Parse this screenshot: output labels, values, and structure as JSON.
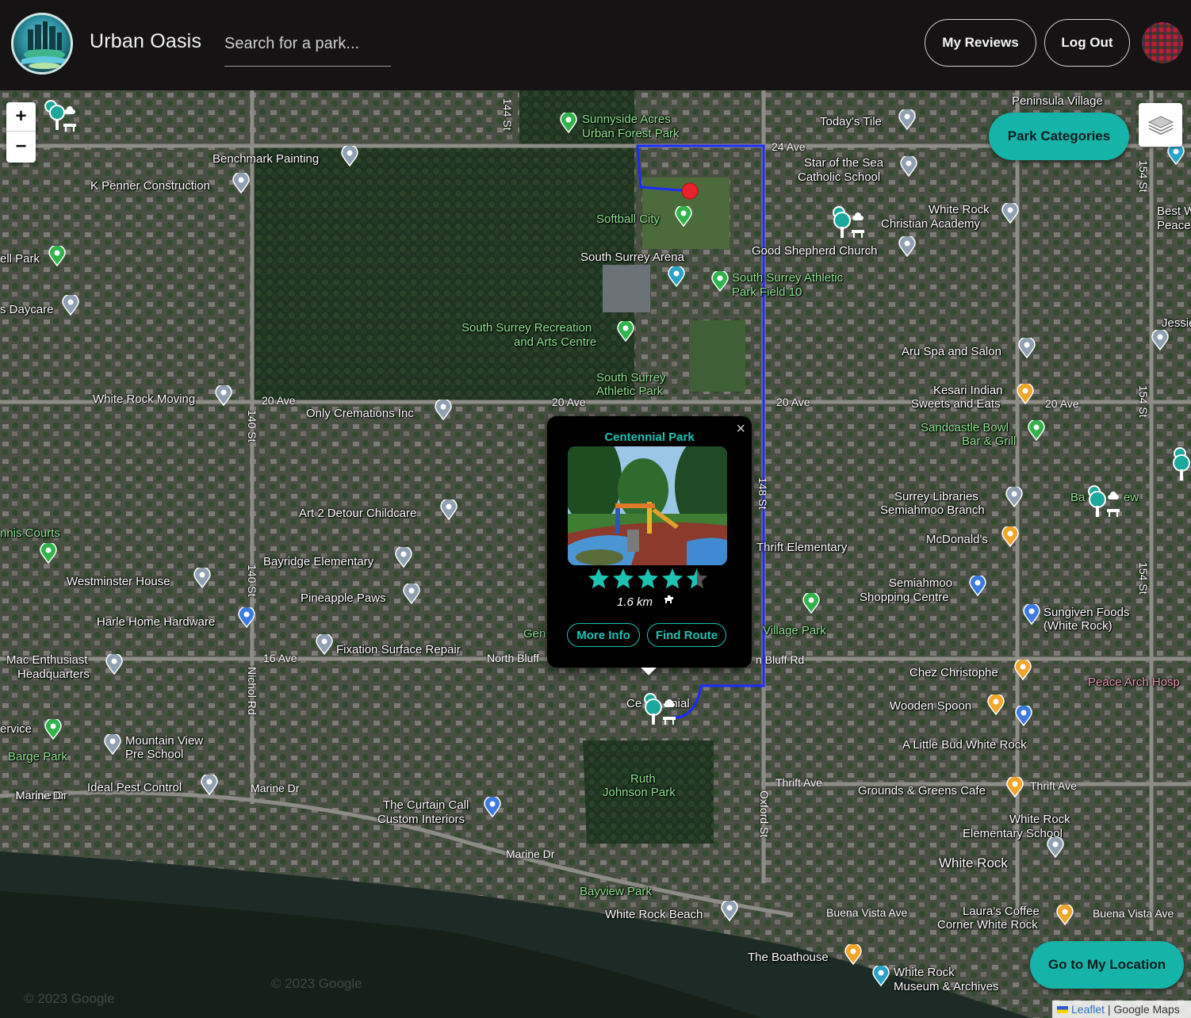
{
  "header": {
    "app_title": "Urban Oasis",
    "search_placeholder": "Search for a park...",
    "my_reviews_label": "My Reviews",
    "logout_label": "Log Out"
  },
  "map": {
    "zoom_in_label": "+",
    "zoom_out_label": "−",
    "park_categories_label": "Park Categories",
    "go_to_location_label": "Go to My Location",
    "attribution": {
      "leaflet": "Leaflet",
      "separator": " | ",
      "provider": "Google Maps"
    },
    "watermarks": [
      "© 2023 Google",
      "© 2023 Google"
    ],
    "road_labels": [
      "144 St",
      "24 Ave",
      "154 St",
      "20 Ave",
      "20 Ave",
      "20 Ave",
      "20 Ave",
      "140 St",
      "140 St",
      "16 Ave",
      "Nichol Rd",
      "Marine Dr",
      "Marine Dr",
      "Marine Dr",
      "Oxford St",
      "Thrift Ave",
      "Thrift Ave",
      "Buena Vista Ave",
      "Buena Vista Ave",
      "154 St",
      "154 St",
      "North Bluff",
      "n Bluff Rd",
      "148 St"
    ],
    "place_labels": [
      "Peninsula Village",
      "Sunnyside Acres",
      "Urban Forest Park",
      "Today's Tile",
      "Star of the Sea",
      "Catholic School",
      "Benchmark Painting",
      "K Penner Construction",
      "Softball City",
      "White Rock",
      "Christian Academy",
      "Best We",
      "Peace Ar",
      "ell Park",
      "South Surrey Arena",
      "Good Shepherd Church",
      "South Surrey Athletic",
      "Park Field 10",
      "s Daycare",
      "Jessie L",
      "South Surrey Recreation",
      "and Arts Centre",
      "Aru Spa and Salon",
      "South Surrey",
      "Athletic Park",
      "Kesari Indian",
      "Sweets and Eats",
      "White Rock Moving",
      "Only Cremations Inc",
      "Sandcastle Bowl",
      "Bar & Grill",
      "Surrey Libraries",
      "Semiahmoo Branch",
      "Ba",
      "ew",
      "nnis Courts",
      "Art 2 Detour Childcare",
      "McDonald's",
      "Thrift Elementary",
      "Bayridge Elementary",
      "Westminster House",
      "Semiahmoo",
      "Shopping Centre",
      "Pineapple Paws",
      "Harle Home Hardware",
      "Sungiven Foods",
      "(White Rock)",
      "Village Park",
      "Gen",
      "Mac Enthusiast",
      "Headquarters",
      "Fixation Surface Repair",
      "Chez Christophe",
      "Peace Arch Hosp",
      "Ce",
      "nnial",
      "Wooden Spoon",
      "ervice",
      "Mountain View",
      "Pre School",
      "A Little Bud White Rock",
      "Barge Park",
      "Ruth",
      "Johnson Park",
      "Marine Dr",
      "Ideal Pest Control",
      "Grounds & Greens Cafe",
      "The Curtain Call",
      "Custom Interiors",
      "White Rock",
      "Elementary School",
      "White Rock",
      "Bayview Park",
      "White Rock Beach",
      "Laura's Coffee",
      "Corner White Rock",
      "The Boathouse",
      "White Rock",
      "Museum & Archives"
    ]
  },
  "popup": {
    "close_label": "×",
    "title": "Centennial Park",
    "rating": 4.5,
    "rating_max": 5,
    "distance": "1.6 km",
    "more_info_label": "More Info",
    "find_route_label": "Find Route"
  },
  "colors": {
    "accent": "#16b3a8",
    "popup_accent": "#1cc3b5",
    "route": "#1a2cff",
    "header_bg": "#151313",
    "destination_marker": "#e8222b"
  }
}
